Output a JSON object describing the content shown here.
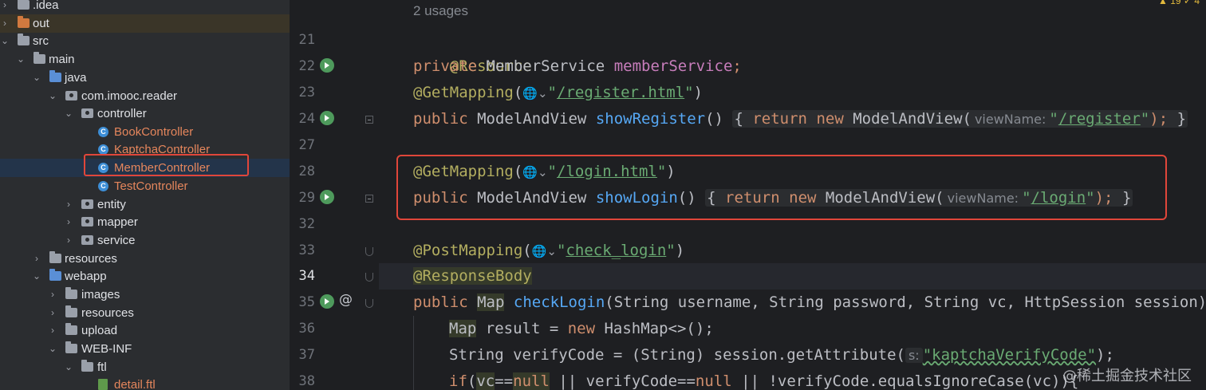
{
  "tree": {
    "items": [
      {
        "label": ".idea",
        "icon": "folder",
        "expanded": false
      },
      {
        "label": "out",
        "icon": "folder-excluded",
        "expanded": false
      },
      {
        "label": "src",
        "icon": "folder",
        "expanded": true
      },
      {
        "label": "main",
        "icon": "folder",
        "expanded": true
      },
      {
        "label": "java",
        "icon": "source-root-folder",
        "expanded": true
      },
      {
        "label": "com.imooc.reader",
        "icon": "package",
        "expanded": true
      },
      {
        "label": "controller",
        "icon": "package",
        "expanded": true
      },
      {
        "label": "BookController",
        "icon": "class"
      },
      {
        "label": "KaptchaController",
        "icon": "class"
      },
      {
        "label": "MemberController",
        "icon": "class",
        "selected": true
      },
      {
        "label": "TestController",
        "icon": "class"
      },
      {
        "label": "entity",
        "icon": "package",
        "expanded": false
      },
      {
        "label": "mapper",
        "icon": "package",
        "expanded": false
      },
      {
        "label": "service",
        "icon": "package",
        "expanded": false
      },
      {
        "label": "resources",
        "icon": "resources-folder",
        "expanded": false
      },
      {
        "label": "webapp",
        "icon": "web-folder",
        "expanded": true
      },
      {
        "label": "images",
        "icon": "folder",
        "expanded": false
      },
      {
        "label": "resources",
        "icon": "folder",
        "expanded": false
      },
      {
        "label": "upload",
        "icon": "folder",
        "expanded": false
      },
      {
        "label": "WEB-INF",
        "icon": "folder",
        "expanded": true
      },
      {
        "label": "ftl",
        "icon": "folder",
        "expanded": true
      },
      {
        "label": "detail.ftl",
        "icon": "ftl-file"
      }
    ]
  },
  "editor": {
    "usages": "2 usages",
    "warnings": "▲ 19  ✓ 4",
    "line_numbers": [
      "21",
      "22",
      "23",
      "24",
      "27",
      "28",
      "29",
      "32",
      "33",
      "34",
      "35",
      "36",
      "37",
      "38"
    ],
    "lines": {
      "l21": {
        "ann": "@Resource"
      },
      "l22": {
        "kw": "private",
        "type": "MemberService",
        "field": "memberService",
        "end": ";"
      },
      "l23": {
        "ann": "@GetMapping",
        "open": "(",
        "globe": "🌐⌄",
        "q1": "\"",
        "path": "/register.html",
        "q2": "\"",
        "close": ")"
      },
      "l24": {
        "kw": "public",
        "type": "ModelAndView",
        "method": "showRegister",
        "paren": "()",
        "brace_open": "{",
        "ret": "return",
        "new": "new",
        "ctor": "ModelAndView(",
        "hint": "viewName:",
        "q1": "\"",
        "path": "/register",
        "q2": "\"",
        "tail": ");",
        "brace_close": "}"
      },
      "l28": {
        "ann": "@GetMapping",
        "open": "(",
        "globe": "🌐⌄",
        "q1": "\"",
        "path": "/login.html",
        "q2": "\"",
        "close": ")"
      },
      "l29": {
        "kw": "public",
        "type": "ModelAndView",
        "method": "showLogin",
        "paren": "()",
        "brace_open": "{",
        "ret": "return",
        "new": "new",
        "ctor": "ModelAndView(",
        "hint": "viewName:",
        "q1": "\"",
        "path": "/login",
        "q2": "\"",
        "tail": ");",
        "brace_close": "}"
      },
      "l33": {
        "ann": "@PostMapping",
        "open": "(",
        "globe": "🌐⌄",
        "q1": "\"",
        "path": "check_login",
        "q2": "\"",
        "close": ")"
      },
      "l34": {
        "ann": "@ResponseBody"
      },
      "l35": {
        "kw": "public",
        "type": "Map",
        "method": "checkLogin",
        "params": "(String username, String password, String vc, HttpSession session){"
      },
      "l36": {
        "type": "Map",
        "rest1": " result = ",
        "new": "new",
        "rest2": " HashMap<>();"
      },
      "l37": {
        "pre": "String verifyCode = (String) session.getAttribute(",
        "hint": "s:",
        "str": "\"kaptchaVerifyCode\"",
        "tail": ");"
      },
      "l38": {
        "kw": "if",
        "pre": "(",
        "v1": "vc",
        "op1": "==",
        "n1": "null",
        "mid": " || verifyCode==",
        "n2": "null",
        "tail": " || !verifyCode.equalsIgnoreCase(vc)){"
      }
    }
  },
  "watermark": "@稀土掘金技术社区"
}
